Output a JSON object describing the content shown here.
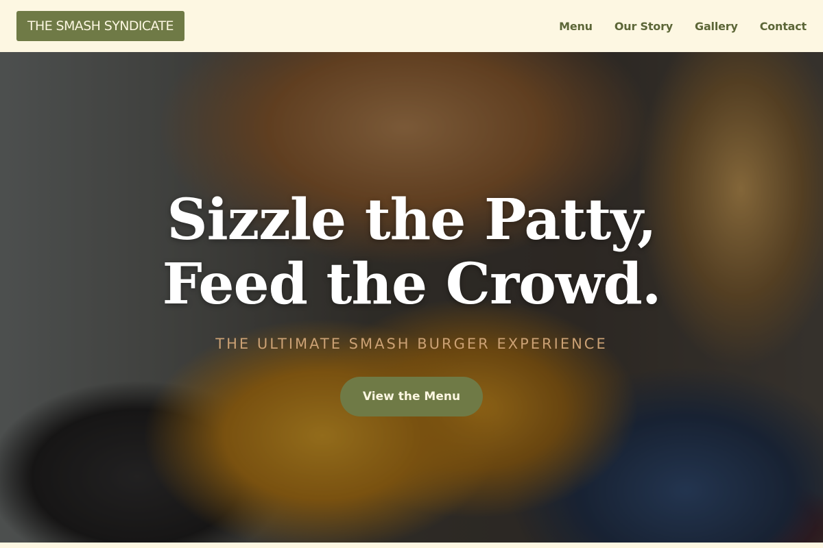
{
  "header": {
    "logo": "THE SMASH SYNDICATE",
    "nav": [
      {
        "label": "Menu"
      },
      {
        "label": "Our Story"
      },
      {
        "label": "Gallery"
      },
      {
        "label": "Contact"
      }
    ]
  },
  "hero": {
    "title_line1": "Sizzle the Patty,",
    "title_line2": "Feed the Crowd.",
    "subtitle": "THE ULTIMATE SMASH BURGER EXPERIENCE",
    "cta_label": "View the Menu"
  },
  "colors": {
    "header_bg": "#fdf7e2",
    "accent": "#6f7a46",
    "nav_text": "#5c6637",
    "subtitle": "#cba174"
  }
}
